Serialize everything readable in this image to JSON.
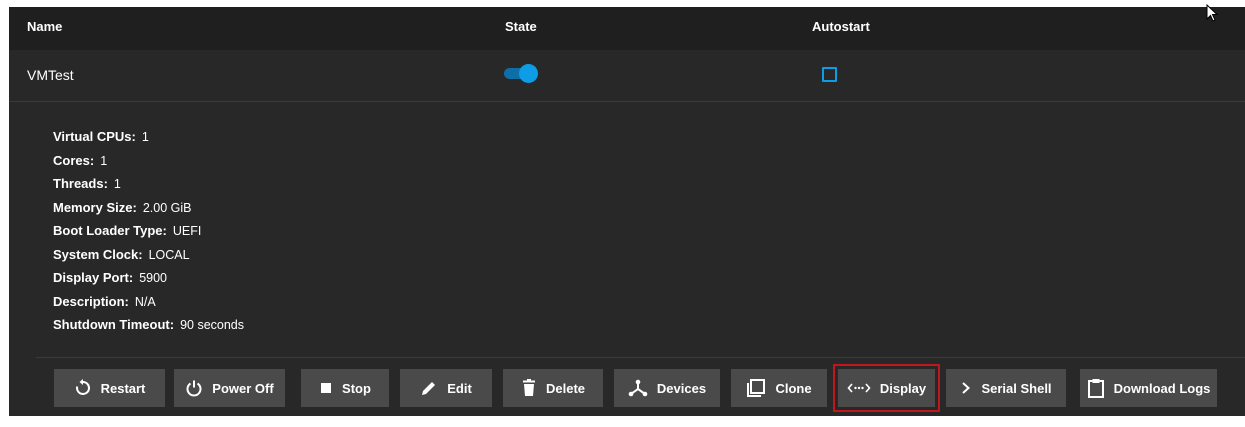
{
  "table": {
    "headers": {
      "name": "Name",
      "state": "State",
      "autostart": "Autostart"
    }
  },
  "vm": {
    "name": "VMTest",
    "state_on": true,
    "autostart": false,
    "details": [
      {
        "key": "Virtual CPUs:",
        "value": "1"
      },
      {
        "key": "Cores:",
        "value": "1"
      },
      {
        "key": "Threads:",
        "value": "1"
      },
      {
        "key": "Memory Size:",
        "value": "2.00 GiB"
      },
      {
        "key": "Boot Loader Type:",
        "value": "UEFI"
      },
      {
        "key": "System Clock:",
        "value": "LOCAL"
      },
      {
        "key": "Display Port:",
        "value": "5900"
      },
      {
        "key": "Description:",
        "value": "N/A"
      },
      {
        "key": "Shutdown Timeout:",
        "value": "90 seconds"
      }
    ]
  },
  "actions": [
    {
      "label": "Restart",
      "icon": "restart-icon"
    },
    {
      "label": "Power Off",
      "icon": "power-icon"
    },
    {
      "label": "Stop",
      "icon": "stop-icon"
    },
    {
      "label": "Edit",
      "icon": "pencil-icon"
    },
    {
      "label": "Delete",
      "icon": "trash-icon"
    },
    {
      "label": "Devices",
      "icon": "devices-icon"
    },
    {
      "label": "Clone",
      "icon": "clone-icon"
    },
    {
      "label": "Display",
      "icon": "display-icon",
      "highlighted": true
    },
    {
      "label": "Serial Shell",
      "icon": "chevron-right-icon"
    },
    {
      "label": "Download Logs",
      "icon": "clipboard-icon"
    }
  ],
  "colors": {
    "accent": "#0e9ce6",
    "panel_bg": "#282828",
    "header_bg": "#1f1f1f",
    "button_bg": "#4a4a4a",
    "highlight": "#c0161c"
  }
}
